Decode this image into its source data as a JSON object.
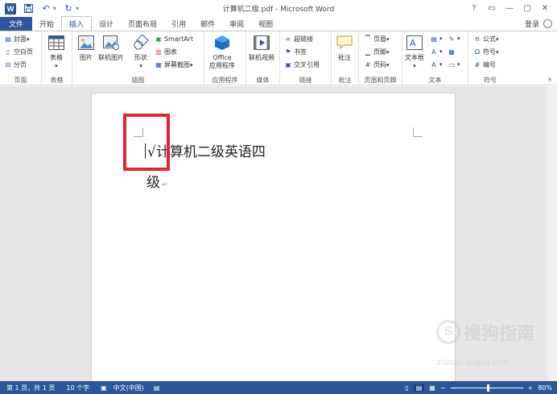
{
  "app": {
    "title": "计算机二级.pdf - Microsoft Word",
    "logo_letter": "W",
    "login_label": "登录",
    "window_controls": [
      "?",
      "▭",
      "—",
      "▢",
      "✕"
    ]
  },
  "tabs": {
    "file": "文件",
    "items": [
      "开始",
      "插入",
      "设计",
      "页面布局",
      "引用",
      "邮件",
      "审阅",
      "视图"
    ],
    "active_index": 1
  },
  "ribbon": {
    "pages": {
      "label": "页面",
      "items": [
        "封面",
        "空白页",
        "分页"
      ]
    },
    "table": {
      "label": "表格",
      "button": "表格"
    },
    "illustrations": {
      "label": "插图",
      "picture": "图片",
      "online_picture": "联机图片",
      "shapes": "形状",
      "smartart": "SmartArt",
      "chart": "图表",
      "screenshot": "屏幕截图"
    },
    "apps": {
      "label": "应用程序",
      "office_line1": "Office",
      "office_line2": "应用程序"
    },
    "media": {
      "label": "媒体",
      "online_video": "联机视频"
    },
    "links": {
      "label": "链接",
      "hyperlink": "超链接",
      "bookmark": "书签",
      "cross_ref": "交叉引用"
    },
    "comments": {
      "label": "批注",
      "comment": "批注"
    },
    "header_footer": {
      "label": "页眉和页脚",
      "header": "页眉",
      "footer": "页脚",
      "page_number": "页码"
    },
    "text": {
      "label": "文本",
      "textbox": "文本框"
    },
    "symbols": {
      "label": "符号",
      "equation": "公式",
      "symbol": "符号",
      "numbering": "编号"
    }
  },
  "document": {
    "line1": "√计算机二级英语四",
    "line2": "级"
  },
  "statusbar": {
    "page_info": "第 1 页，共 1 页",
    "word_count": "10 个字",
    "language": "中文(中国)",
    "zoom_level": "80%",
    "zoom_fraction": 0.5
  },
  "watermark": {
    "glyph": "S",
    "text": "搜狗指南",
    "url": "zhinan.sogou.com"
  },
  "colors": {
    "accent": "#2b579a",
    "highlight": "#e6232b"
  }
}
